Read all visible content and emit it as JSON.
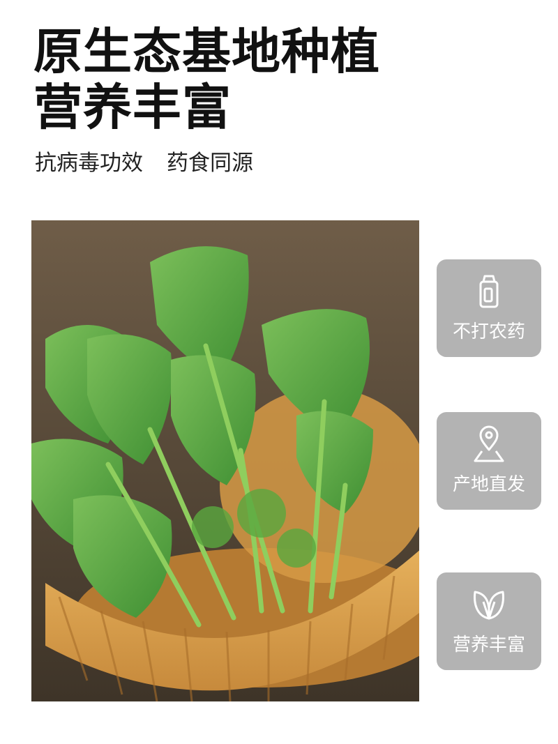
{
  "headline": {
    "line1": "原生态基地种植",
    "line2": "营养丰富"
  },
  "subtitle": {
    "left": "抗病毒功效",
    "right": "药食同源"
  },
  "badges": [
    {
      "label": "不打农药",
      "icon": "bottle-icon"
    },
    {
      "label": "产地直发",
      "icon": "map-pin-icon"
    },
    {
      "label": "营养丰富",
      "icon": "leaf-icon"
    }
  ],
  "colors": {
    "badge_bg": "#b3b3b3",
    "text": "#111111"
  }
}
